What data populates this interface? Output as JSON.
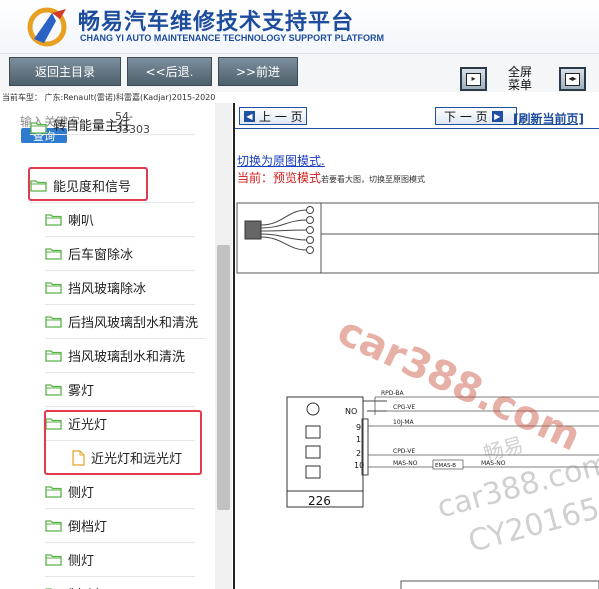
{
  "header": {
    "title_cn": "畅易汽车维修技术支持平台",
    "title_en": "CHANG YI AUTO MAINTENANCE TECHNOLOGY SUPPORT PLATFORM"
  },
  "toolbar": {
    "home": "返回主目录",
    "back": "<<后退.",
    "forward": ">>前进",
    "fullscreen_l1": "全屏",
    "fullscreen_l2": "菜单"
  },
  "car_info": "当前车型： 广东:Renault(雷诺)科雷嘉(Kadjar)2015-2020",
  "search": {
    "placeholder": "输入关键字",
    "code_l1": "54-",
    "code_l2": "33303",
    "button": "查询"
  },
  "tree": [
    {
      "label": "转自能量主任",
      "icon": "folder",
      "partial": true
    },
    {
      "label": "能见度和信号",
      "icon": "folder"
    },
    {
      "label": "喇叭",
      "icon": "folder"
    },
    {
      "label": "后车窗除冰",
      "icon": "folder"
    },
    {
      "label": "挡风玻璃除冰",
      "icon": "folder"
    },
    {
      "label": "后挡风玻璃刮水和清洗",
      "icon": "folder"
    },
    {
      "label": "挡风玻璃刮水和清洗",
      "icon": "folder"
    },
    {
      "label": "雾灯",
      "icon": "folder"
    },
    {
      "label": "近光灯",
      "icon": "folder"
    },
    {
      "label": "近光灯和远光灯",
      "icon": "doc"
    },
    {
      "label": "侧灯",
      "icon": "folder"
    },
    {
      "label": "倒档灯",
      "icon": "folder"
    },
    {
      "label": "侧灯",
      "icon": "folder"
    },
    {
      "label": "制动灯",
      "icon": "folder"
    }
  ],
  "viewer": {
    "prev": "上 一 页",
    "next": "下 一 页",
    "refresh": "[刷新当前页]",
    "switch": "切换为原图模式.",
    "mode_prefix": "当前：",
    "mode_name": "预览模式",
    "mode_hint": "若要看大图，切换至原图模式"
  },
  "diagram": {
    "terminal_no": "NO",
    "pins": [
      "9",
      "1",
      "2",
      "10"
    ],
    "signals": [
      "RPD-BA",
      "CPG-VE",
      "10J-MA",
      "CPD-VE",
      "MAS-NO",
      "EMAS-B",
      "MAS-NO"
    ],
    "component_id": "226"
  },
  "watermark": {
    "main": "car388.com",
    "cn": "畅易",
    "url": "car388.com",
    "code": "CY20165"
  },
  "colors": {
    "brand_blue": "#1d4c9c",
    "highlight_red": "#e33a4c",
    "folder_green": "#5ab24a"
  }
}
